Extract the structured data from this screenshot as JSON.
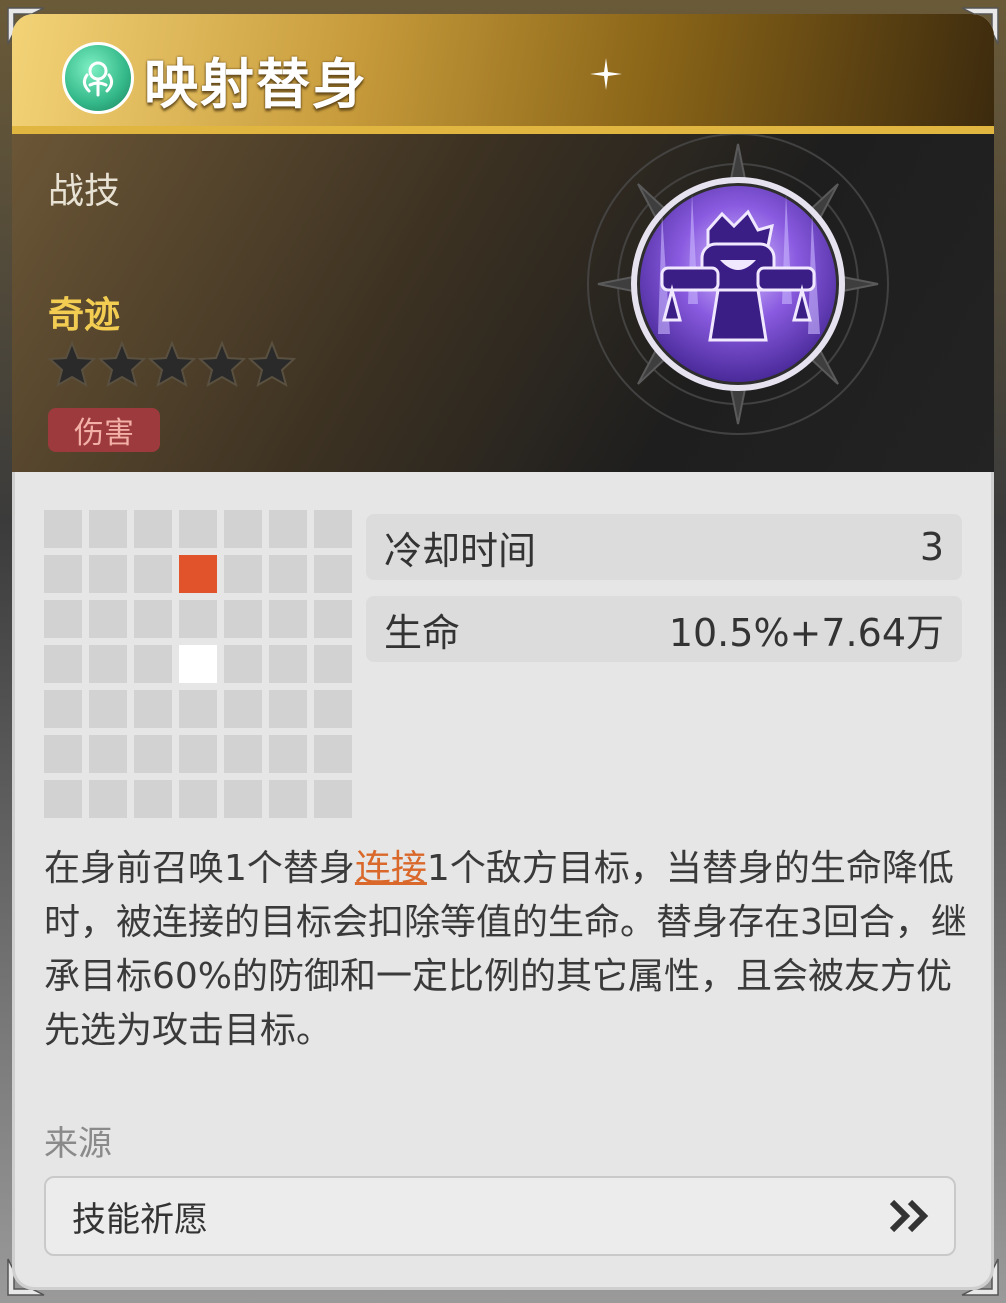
{
  "header": {
    "title": "映射替身"
  },
  "hero": {
    "skill_type": "战技",
    "rarity": "奇迹",
    "stars_total": 5,
    "stars_filled": 0,
    "tag": "伤害"
  },
  "range_grid": {
    "rows": 7,
    "cols": 7,
    "target_cells": [
      [
        1,
        3
      ]
    ],
    "self_cells": [
      [
        3,
        3
      ]
    ]
  },
  "stats": [
    {
      "label": "冷却时间",
      "value": "3"
    },
    {
      "label": "生命",
      "value": "10.5%+7.64万"
    }
  ],
  "description": {
    "before": "在身前召唤1个替身",
    "link": "连接",
    "after": "1个敌方目标，当替身的生命降低时，被连接的目标会扣除等值的生命。替身存在3回合，继承目标60%的防御和一定比例的其它属性，且会被友方优先选为攻击目标。"
  },
  "source": {
    "label": "来源",
    "button": "技能祈愿"
  },
  "colors": {
    "target": "#e0532b",
    "self": "#ffffff",
    "rarity": "#f2cd52",
    "link": "#d9682a",
    "tag_bg": "#9d3a3e"
  },
  "icons": [
    "emblem-icon",
    "sparkle-icon",
    "star-icon",
    "skill-compass-icon",
    "double-chevron-right-icon",
    "corner-ornament-icon"
  ]
}
